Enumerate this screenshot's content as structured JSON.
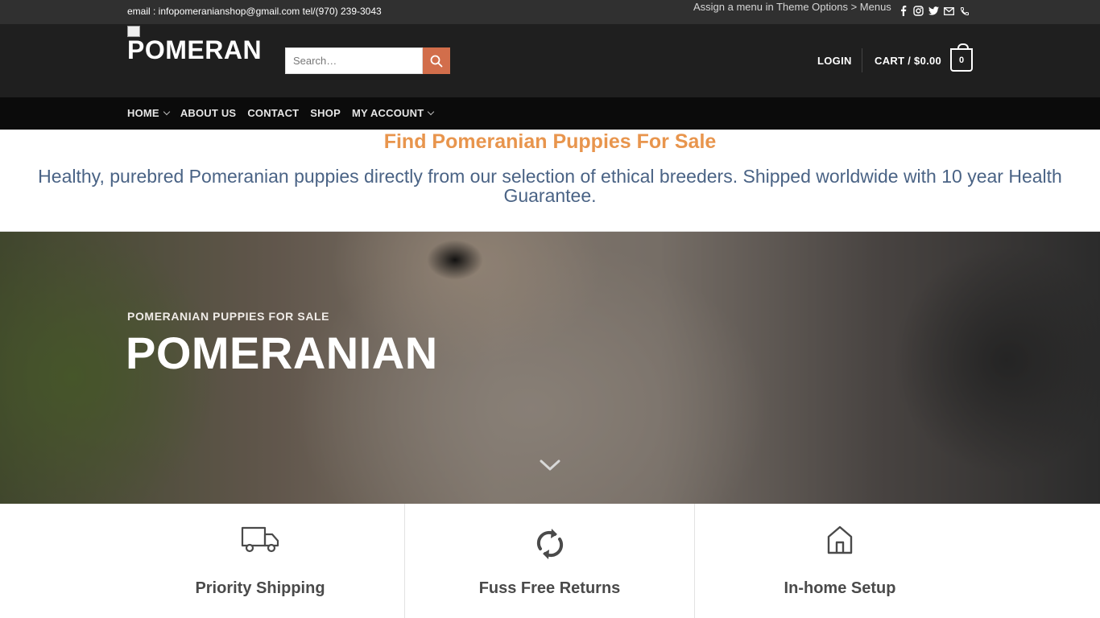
{
  "topbar": {
    "contact_text": "email : infopomeranianshop@gmail.com tel/(970) 239-3043",
    "menu_note": "Assign a menu in Theme Options > Menus",
    "socials": [
      "facebook-icon",
      "instagram-icon",
      "twitter-icon",
      "email-icon",
      "phone-icon"
    ]
  },
  "header": {
    "logo_text": "POMERANI",
    "search": {
      "placeholder": "Search…"
    },
    "login_label": "LOGIN",
    "cart_label": "CART / $0.00",
    "cart_count": "0"
  },
  "nav": {
    "items": [
      {
        "label": "HOME",
        "dropdown": true
      },
      {
        "label": "ABOUT US",
        "dropdown": false
      },
      {
        "label": "CONTACT",
        "dropdown": false
      },
      {
        "label": "SHOP",
        "dropdown": false
      },
      {
        "label": "MY ACCOUNT",
        "dropdown": true
      }
    ]
  },
  "intro": {
    "title": "Find Pomeranian Puppies For Sale",
    "subtitle": "Healthy, purebred Pomeranian puppies directly from our selection of ethical breeders. Shipped worldwide with 10 year Health Guarantee."
  },
  "hero": {
    "kicker": "POMERANIAN PUPPIES FOR SALE",
    "title": "POMERANIAN"
  },
  "features": [
    {
      "title": "Priority Shipping",
      "icon": "truck-icon"
    },
    {
      "title": "Fuss Free Returns",
      "icon": "refresh-icon"
    },
    {
      "title": "In-home Setup",
      "icon": "home-icon"
    }
  ],
  "colors": {
    "topbar_bg": "#303030",
    "header_bg": "#1f1f1f",
    "nav_bg": "#0b0b0b",
    "accent_search": "#d26e4b",
    "intro_title": "#e8954d",
    "intro_sub": "#4a6385"
  }
}
